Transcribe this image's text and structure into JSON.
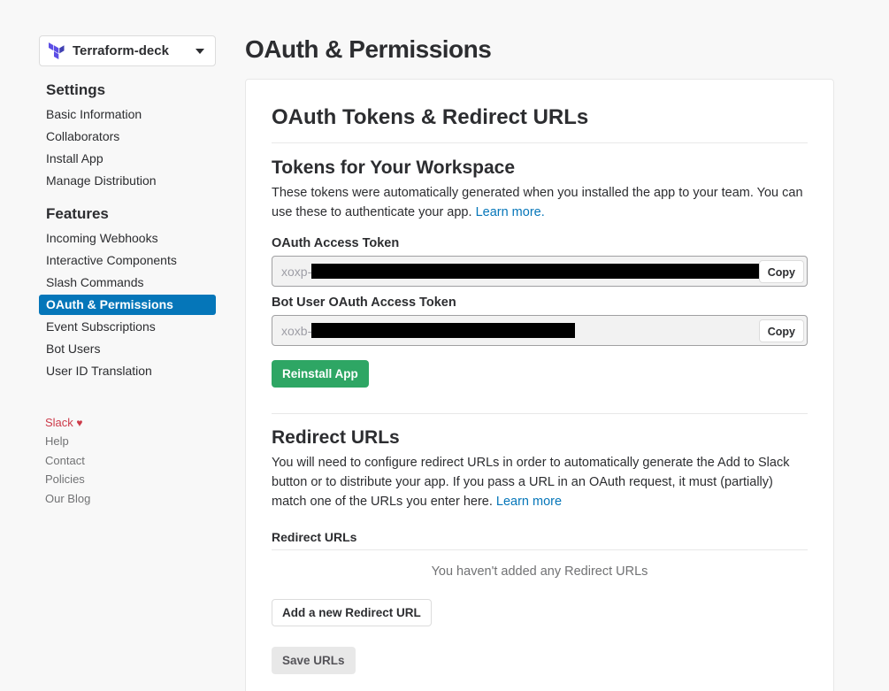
{
  "app": {
    "name": "Terraform-deck",
    "brand_color": "#5c4ee5"
  },
  "sidebar": {
    "settings_title": "Settings",
    "settings_items": [
      "Basic Information",
      "Collaborators",
      "Install App",
      "Manage Distribution"
    ],
    "features_title": "Features",
    "features_items": [
      "Incoming Webhooks",
      "Interactive Components",
      "Slash Commands",
      "OAuth & Permissions",
      "Event Subscriptions",
      "Bot Users",
      "User ID Translation"
    ],
    "active_item": "OAuth & Permissions",
    "footer": {
      "slack": "Slack",
      "links": [
        "Help",
        "Contact",
        "Policies",
        "Our Blog"
      ]
    }
  },
  "page": {
    "title": "OAuth & Permissions"
  },
  "card": {
    "title": "OAuth Tokens & Redirect URLs",
    "tokens": {
      "title": "Tokens for Your Workspace",
      "description": "These tokens were automatically generated when you installed the app to your team. You can use these to authenticate your app.",
      "learn_more": "Learn more.",
      "oauth_label": "OAuth Access Token",
      "oauth_prefix": "xoxp-",
      "bot_label": "Bot User OAuth Access Token",
      "bot_prefix": "xoxb-",
      "copy_label": "Copy",
      "reinstall_label": "Reinstall App"
    },
    "redirect": {
      "title": "Redirect URLs",
      "description": "You will need to configure redirect URLs in order to automatically generate the Add to Slack button or to distribute your app. If you pass a URL in an OAuth request, it must (partially) match one of the URLs you enter here.",
      "learn_more": "Learn more",
      "list_label": "Redirect URLs",
      "empty": "You haven't added any Redirect URLs",
      "add_label": "Add a new Redirect URL",
      "save_label": "Save URLs"
    }
  }
}
